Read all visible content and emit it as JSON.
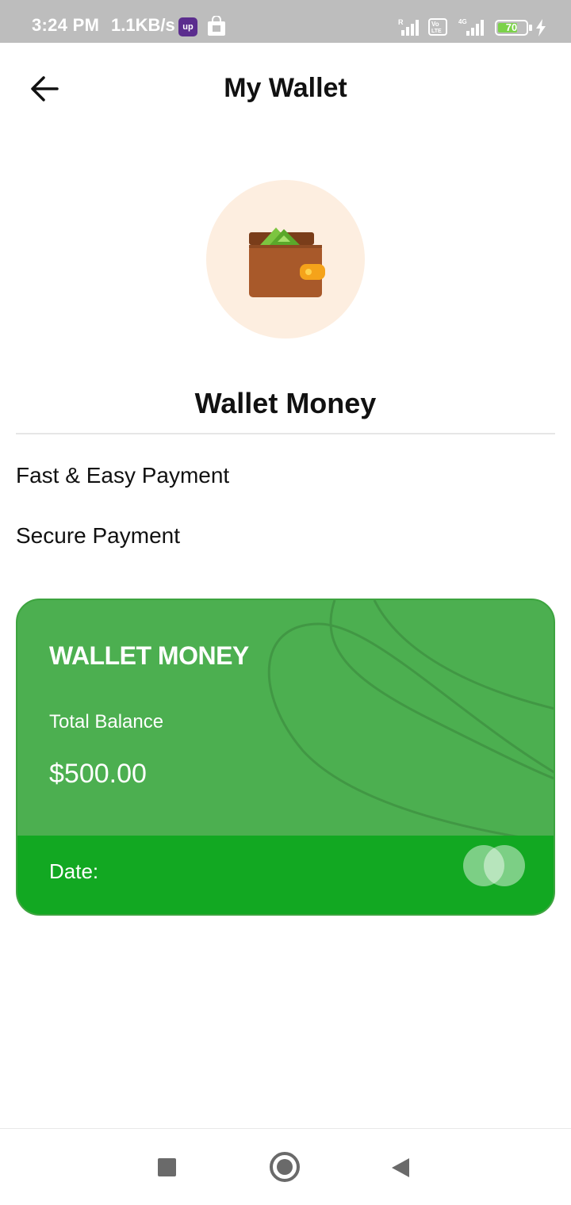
{
  "status_bar": {
    "time": "3:24 PM",
    "speed": "1.1KB/s",
    "app_badge": "up",
    "battery": "70",
    "battery_level_pct": 70
  },
  "header": {
    "title": "My Wallet",
    "back_icon": "arrow-left-icon"
  },
  "wallet": {
    "icon": "wallet-icon",
    "heading": "Wallet Money"
  },
  "features": [
    {
      "label": "Fast & Easy Payment"
    },
    {
      "label": "Secure Payment"
    }
  ],
  "card": {
    "title": "WALLET MONEY",
    "balance_label": "Total Balance",
    "balance_value": "$500.00",
    "date_label": "Date:",
    "logo": "card-network-logo",
    "colors": {
      "body": "#4caf50",
      "footer": "#12a822"
    }
  },
  "nav_bar": {
    "recents_icon": "square-icon",
    "home_icon": "circle-icon",
    "back_icon": "triangle-back-icon"
  }
}
